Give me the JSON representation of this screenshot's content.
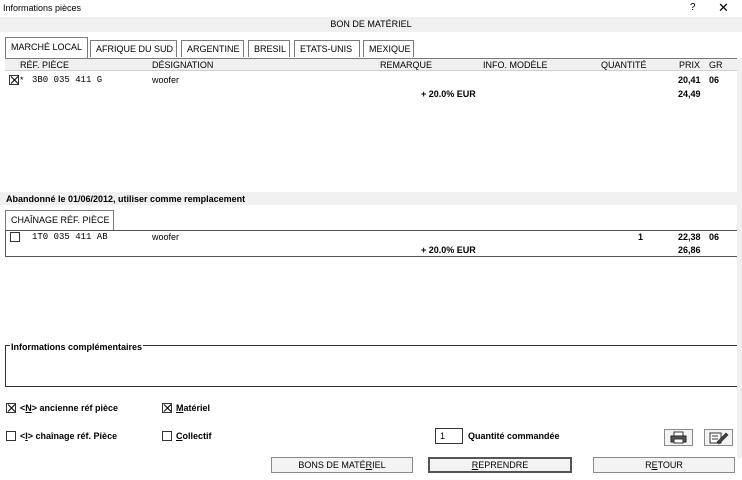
{
  "window": {
    "title": "Informations pièces",
    "help": "?",
    "close": "✕"
  },
  "header": {
    "title": "BON DE MATÉRIEL"
  },
  "tabs": [
    {
      "label": "MARCHÉ LOCAL"
    },
    {
      "label": "AFRIQUE DU SUD"
    },
    {
      "label": "ARGENTINE"
    },
    {
      "label": "BRESIL"
    },
    {
      "label": "ETATS-UNIS"
    },
    {
      "label": "MEXIQUE"
    }
  ],
  "table": {
    "columns": {
      "ref": "RÉF. PIÈCE",
      "designation": "DÉSIGNATION",
      "remarque": "REMARQUE",
      "info_modele": "INFO. MODÈLE",
      "quantite": "QUANTITÉ",
      "prix": "PRIX",
      "gr": "GR"
    },
    "rows": [
      {
        "marker": "*",
        "ref": "3B0 035 411 G",
        "designation": "woofer",
        "prix": "20,41",
        "gr": "06",
        "tax_label": "+ 20.0% EUR",
        "prix_ttc": "24,49"
      }
    ]
  },
  "notice": {
    "text": "Abandonné le 01/06/2012, utiliser comme remplacement"
  },
  "chain_tab": {
    "label": "CHAÎNAGE RÉF. PIÈCE"
  },
  "chain_rows": [
    {
      "ref": "1T0 035 411 AB",
      "designation": "woofer",
      "quantite": "1",
      "prix": "22,38",
      "gr": "06",
      "tax_label": "+ 20.0% EUR",
      "prix_ttc": "26,86"
    }
  ],
  "info": {
    "label": "Informations complémentaires"
  },
  "options": {
    "ancienne": {
      "prefix": "<",
      "key": "N",
      "suffix": "> ancienne réf pièce"
    },
    "chainage": {
      "prefix": "<",
      "key": "I",
      "suffix": "> chaînage réf. Pièce"
    },
    "materiel": {
      "key": "M",
      "rest": "atériel"
    },
    "collectif": {
      "key": "C",
      "rest": "ollectif"
    }
  },
  "quantity": {
    "value": "1",
    "label": "Quantité commandée"
  },
  "buttons": {
    "bons": {
      "pre": "BONS DE MATÉ",
      "key": "R",
      "post": "IEL"
    },
    "reprendre": {
      "pre": "",
      "key": "R",
      "post": "EPRENDRE"
    },
    "retour": {
      "pre": "R",
      "key": "E",
      "post": "TOUR"
    }
  },
  "icons": {
    "print": "printer-icon",
    "edit": "edit-icon"
  }
}
